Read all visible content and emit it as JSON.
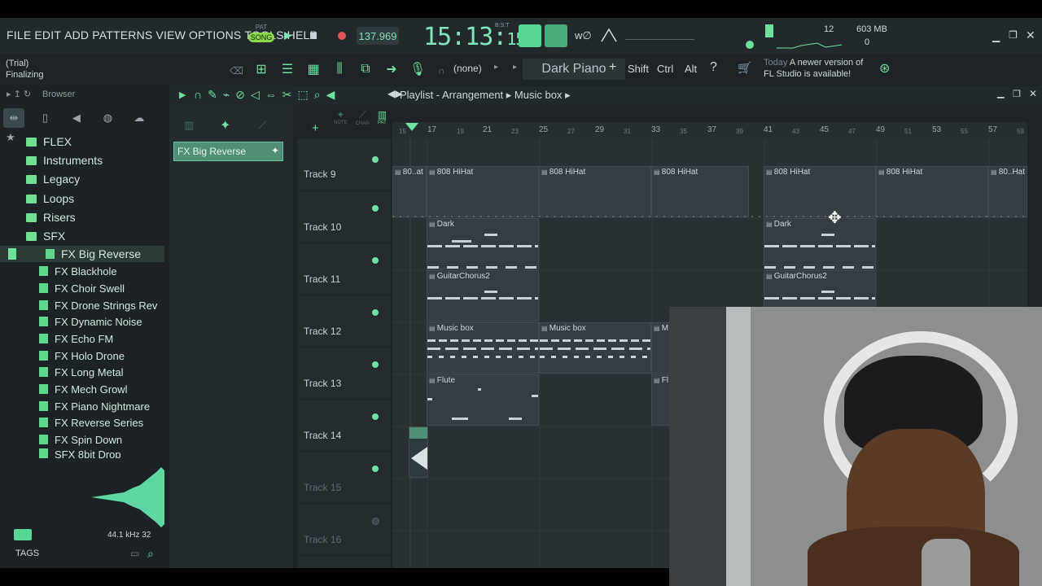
{
  "menu": [
    "FILE",
    "EDIT",
    "ADD",
    "PATTERNS",
    "VIEW",
    "OPTIONS",
    "TOOLS",
    "HELP"
  ],
  "transport": {
    "pat_label": "PAT",
    "song_label": "SONG",
    "tempo": "137.969"
  },
  "clock": {
    "main": "15:13:",
    "sec": "15",
    "bst": "B:S:T"
  },
  "cpu": {
    "value": "12",
    "memory": "603 MB",
    "voices": "0"
  },
  "status": {
    "trial": "(Trial)",
    "action": "Finalizing"
  },
  "preset": {
    "none_label": "(none)",
    "name": "Dark Piano"
  },
  "modifiers": {
    "shift": "Shift",
    "ctrl": "Ctrl",
    "alt": "Alt"
  },
  "news": {
    "today": "Today",
    "line1": "A newer version of",
    "line2": "FL Studio is available!"
  },
  "browser": {
    "title": "Browser",
    "folders": [
      "FLEX",
      "Instruments",
      "Legacy",
      "Loops",
      "Risers",
      "SFX"
    ],
    "selected": "FX Big Reverse",
    "files": [
      "FX Blackhole",
      "FX Choir Swell",
      "FX Drone Strings Rev",
      "FX Dynamic Noise",
      "FX Echo FM",
      "FX Holo Drone",
      "FX Long Metal",
      "FX Mech Growl",
      "FX Piano Nightmare",
      "FX Reverse Series",
      "FX Spin Down",
      "SFX 8bit Drop"
    ],
    "sample_rate": "44.1 kHz 32",
    "tags": "TAGS"
  },
  "pattern_item": "FX Big Reverse",
  "playlist": {
    "title": "Playlist - Arrangement",
    "pattern": "Music box",
    "ruler_major": [
      "17",
      "21",
      "25",
      "29",
      "33",
      "37",
      "41",
      "45",
      "49",
      "53",
      "57"
    ],
    "ruler_minor": [
      "15",
      "19",
      "23",
      "27",
      "31",
      "35",
      "39",
      "43",
      "47",
      "51",
      "55",
      "59"
    ],
    "tracks": [
      "Track 9",
      "Track 10",
      "Track 11",
      "Track 12",
      "Track 13",
      "Track 14",
      "Track 15",
      "Track 16"
    ],
    "clips": {
      "t9": [
        "80..at",
        "808 HiHat",
        "808 HiHat",
        "808 HiHat",
        "808 HiHat",
        "808 HiHat",
        "80..Hat"
      ],
      "t10": [
        "Dark",
        "Dark"
      ],
      "t11": [
        "GuitarChorus2",
        "GuitarChorus2"
      ],
      "t12": [
        "Music box",
        "Music box",
        "M"
      ],
      "t13": [
        "Flute",
        "Fl"
      ]
    }
  },
  "colors": {
    "accent": "#6ee29d",
    "bg": "#1d2326",
    "clip": "#333d42"
  }
}
